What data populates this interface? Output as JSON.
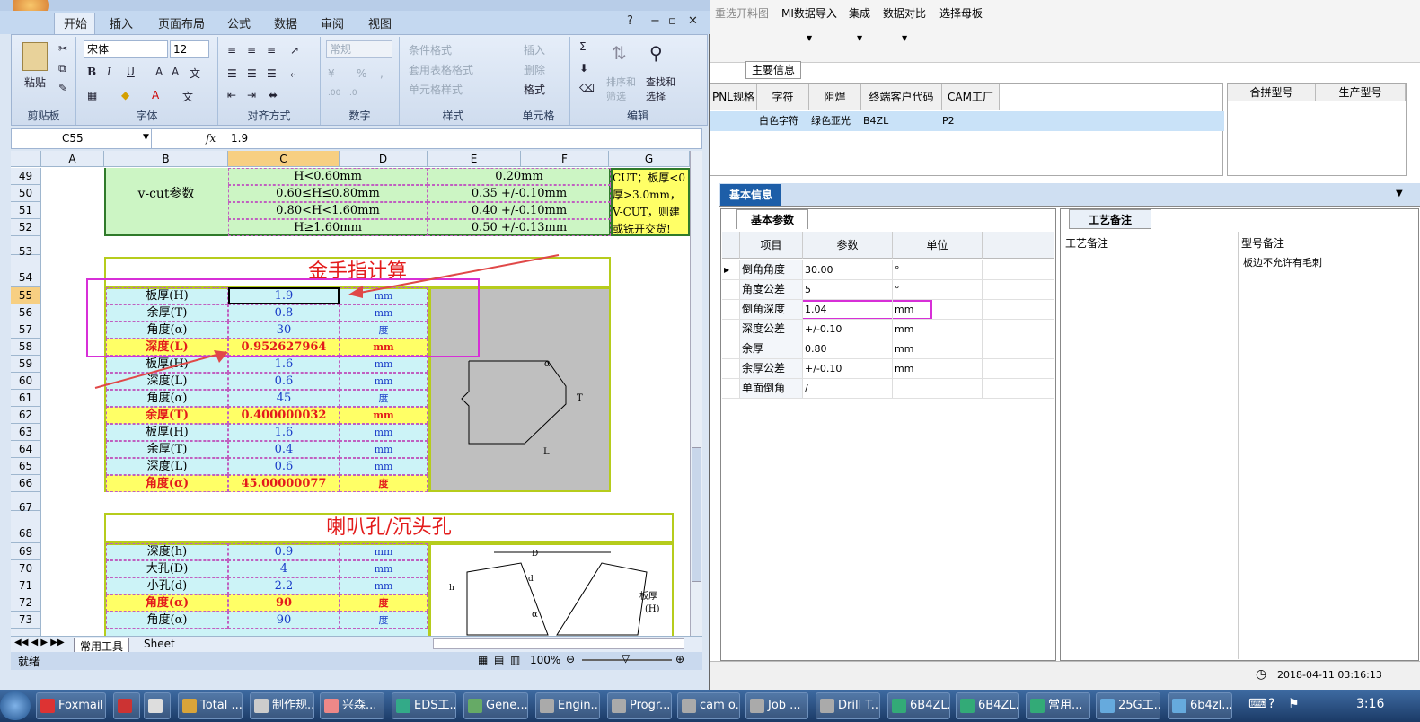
{
  "right_app": {
    "toolbar": [
      "重选开料图",
      "MI数据导入",
      "集成",
      "数据对比",
      "选择母板"
    ],
    "main_info_tab": "主要信息",
    "top_table": {
      "headers": [
        "PNL规格",
        "字符",
        "阻焊",
        "终端客户代码",
        "CAM工厂"
      ],
      "row": [
        "",
        "白色字符",
        "绿色亚光",
        "B4ZL",
        "P2"
      ]
    },
    "merge_headers": [
      "合拼型号",
      "生产型号"
    ],
    "basic_info_tab": "基本信息",
    "basic_params_tab": "基本参数",
    "grid_headers": [
      "项目",
      "参数",
      "单位"
    ],
    "grid_rows": [
      {
        "item": "倒角角度",
        "param": "30.00",
        "unit": "°"
      },
      {
        "item": "角度公差",
        "param": "5",
        "unit": "°"
      },
      {
        "item": "倒角深度",
        "param": "1.04",
        "unit": "mm"
      },
      {
        "item": "深度公差",
        "param": "+/-0.10",
        "unit": "mm"
      },
      {
        "item": "余厚",
        "param": "0.80",
        "unit": "mm"
      },
      {
        "item": "余厚公差",
        "param": "+/-0.10",
        "unit": "mm"
      },
      {
        "item": "单面倒角",
        "param": "/",
        "unit": ""
      }
    ],
    "process_tab": "工艺备注",
    "process_headers": [
      "工艺备注",
      "型号备注"
    ],
    "process_note": "板边不允许有毛刺",
    "datetime": "2018-04-11 03:16:13"
  },
  "excel": {
    "tabs": [
      "开始",
      "插入",
      "页面布局",
      "公式",
      "数据",
      "审阅",
      "视图"
    ],
    "font_name": "宋体",
    "font_size": "12",
    "number_format": "常规",
    "groups": [
      "剪贴板",
      "字体",
      "对齐方式",
      "数字",
      "样式",
      "单元格",
      "编辑"
    ],
    "clip": {
      "paste": "粘贴"
    },
    "style_btns": [
      "条件格式",
      "套用表格格式",
      "单元格样式"
    ],
    "cell_btns": [
      "插入",
      "删除",
      "格式"
    ],
    "edit_btns": [
      "排序和筛选",
      "查找和选择"
    ],
    "name_box": "C55",
    "fx": "fx",
    "formula": "1.9",
    "columns": [
      "A",
      "B",
      "C",
      "D",
      "E",
      "F",
      "G"
    ],
    "vcut": {
      "label": "v-cut参数",
      "rows": [
        {
          "r": "49",
          "c": "H<0.60mm",
          "e": "0.20mm"
        },
        {
          "r": "50",
          "c": "0.60≤H≤0.80mm",
          "e": "0.35 +/-0.10mm"
        },
        {
          "r": "51",
          "c": "0.80<H<1.60mm",
          "e": "0.40 +/-0.10mm"
        },
        {
          "r": "52",
          "c": "H≥1.60mm",
          "e": "0.50 +/-0.13mm"
        }
      ],
      "note": [
        "CUT；板厚<0",
        "厚>3.0mm，",
        "V-CUT，则建",
        "或铣开交货!"
      ]
    },
    "gold_title": "金手指计算",
    "gold_rows": [
      {
        "r": "55",
        "b": "板厚(H)",
        "c": "1.9",
        "d": "mm",
        "hl": false
      },
      {
        "r": "56",
        "b": "余厚(T)",
        "c": "0.8",
        "d": "mm",
        "hl": false
      },
      {
        "r": "57",
        "b": "角度(α)",
        "c": "30",
        "d": "度",
        "hl": false
      },
      {
        "r": "58",
        "b": "深度(L)",
        "c": "0.952627964",
        "d": "mm",
        "hl": true
      },
      {
        "r": "59",
        "b": "板厚(H)",
        "c": "1.6",
        "d": "mm",
        "hl": false
      },
      {
        "r": "60",
        "b": "深度(L)",
        "c": "0.6",
        "d": "mm",
        "hl": false
      },
      {
        "r": "61",
        "b": "角度(α)",
        "c": "45",
        "d": "度",
        "hl": false
      },
      {
        "r": "62",
        "b": "余厚(T)",
        "c": "0.400000032",
        "d": "mm",
        "hl": true
      },
      {
        "r": "63",
        "b": "板厚(H)",
        "c": "1.6",
        "d": "mm",
        "hl": false
      },
      {
        "r": "64",
        "b": "余厚(T)",
        "c": "0.4",
        "d": "mm",
        "hl": false
      },
      {
        "r": "65",
        "b": "深度(L)",
        "c": "0.6",
        "d": "mm",
        "hl": false
      },
      {
        "r": "66",
        "b": "角度(α)",
        "c": "45.00000077",
        "d": "度",
        "hl": true
      }
    ],
    "hole_title": "喇叭孔/沉头孔",
    "hole_rows": [
      {
        "r": "69",
        "b": "深度(h)",
        "c": "0.9",
        "d": "mm",
        "hl": false
      },
      {
        "r": "70",
        "b": "大孔(D)",
        "c": "4",
        "d": "mm",
        "hl": false
      },
      {
        "r": "71",
        "b": "小孔(d)",
        "c": "2.2",
        "d": "mm",
        "hl": false
      },
      {
        "r": "72",
        "b": "角度(α)",
        "c": "90",
        "d": "度",
        "hl": true
      },
      {
        "r": "73",
        "b": "角度(α)",
        "c": "90",
        "d": "度",
        "hl": false
      }
    ],
    "row_53": "53",
    "row_54": "54",
    "row_67": "67",
    "row_68": "68",
    "sheet_tabs": [
      "常用工具",
      "Sheet"
    ],
    "status": "就绪",
    "zoom": "100%",
    "diagram_labels": {
      "alpha": "α",
      "t": "T",
      "l": "L",
      "d_big": "D",
      "d_small": "d",
      "h": "h",
      "board": "板厚",
      "bh": "(H)"
    }
  },
  "taskbar": {
    "items": [
      "Foxmail",
      "",
      "",
      "Total ...",
      "制作规...",
      "兴森...",
      "EDS工...",
      "Gene...",
      "Engin...",
      "Progr...",
      "cam o...",
      "Job ...",
      "Drill T...",
      "6B4ZL...",
      "6B4ZL...",
      "常用...",
      "25G工...",
      "6b4zl..."
    ],
    "clock": "3:16"
  }
}
